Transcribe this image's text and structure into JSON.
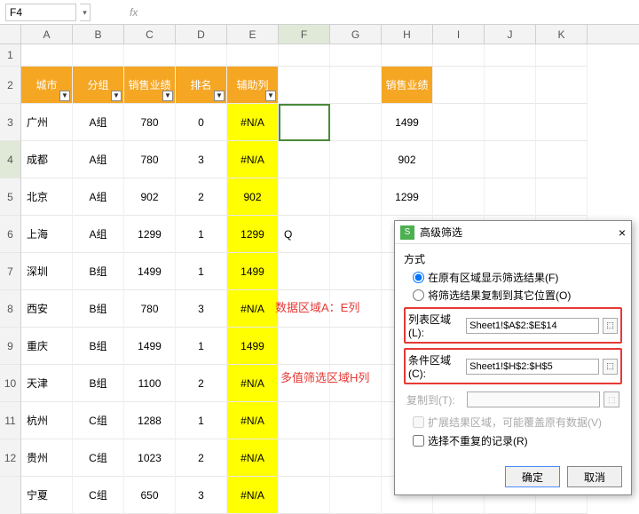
{
  "namebox": "F4",
  "fx": "fx",
  "cols": [
    "A",
    "B",
    "C",
    "D",
    "E",
    "F",
    "G",
    "H",
    "I",
    "J",
    "K"
  ],
  "rows": [
    "1",
    "2",
    "3",
    "4",
    "5",
    "6",
    "7",
    "8",
    "9",
    "10",
    "11",
    "12"
  ],
  "hdr": {
    "a": "城市",
    "b": "分组",
    "c": "销售业绩",
    "d": "排名",
    "e": "辅助列",
    "h": "销售业绩"
  },
  "data": [
    {
      "a": "广州",
      "b": "A组",
      "c": "780",
      "d": "0",
      "e": "#N/A",
      "h": "1499"
    },
    {
      "a": "成都",
      "b": "A组",
      "c": "780",
      "d": "3",
      "e": "#N/A",
      "h": "902"
    },
    {
      "a": "北京",
      "b": "A组",
      "c": "902",
      "d": "2",
      "e": "902",
      "h": "1299"
    },
    {
      "a": "上海",
      "b": "A组",
      "c": "1299",
      "d": "1",
      "e": "1299",
      "h": ""
    },
    {
      "a": "深圳",
      "b": "B组",
      "c": "1499",
      "d": "1",
      "e": "1499",
      "h": ""
    },
    {
      "a": "西安",
      "b": "B组",
      "c": "780",
      "d": "3",
      "e": "#N/A",
      "h": ""
    },
    {
      "a": "重庆",
      "b": "B组",
      "c": "1499",
      "d": "1",
      "e": "1499",
      "h": ""
    },
    {
      "a": "天津",
      "b": "B组",
      "c": "1100",
      "d": "2",
      "e": "#N/A",
      "h": ""
    },
    {
      "a": "杭州",
      "b": "C组",
      "c": "1288",
      "d": "1",
      "e": "#N/A",
      "h": ""
    },
    {
      "a": "贵州",
      "b": "C组",
      "c": "1023",
      "d": "2",
      "e": "#N/A",
      "h": ""
    },
    {
      "a": "宁夏",
      "b": "C组",
      "c": "650",
      "d": "3",
      "e": "#N/A",
      "h": ""
    }
  ],
  "f6": "Q",
  "ann1": "数据区域A：E列",
  "ann2": "多值筛选区域H列",
  "dlg": {
    "title": "高级筛选",
    "mode": "方式",
    "r1": "在原有区域显示筛选结果(F)",
    "r2": "将筛选结果复制到其它位置(O)",
    "list": "列表区域(L):",
    "listv": "Sheet1!$A$2:$E$14",
    "cond": "条件区域(C):",
    "condv": "Sheet1!$H$2:$H$5",
    "copy": "复制到(T):",
    "ext": "扩展结果区域，可能覆盖原有数据(V)",
    "uniq": "选择不重复的记录(R)",
    "ok": "确定",
    "cancel": "取消"
  },
  "chart_data": {
    "type": "table",
    "title": "销售业绩筛选",
    "columns": [
      "城市",
      "分组",
      "销售业绩",
      "排名",
      "辅助列"
    ],
    "rows": [
      [
        "广州",
        "A组",
        780,
        0,
        "#N/A"
      ],
      [
        "成都",
        "A组",
        780,
        3,
        "#N/A"
      ],
      [
        "北京",
        "A组",
        902,
        2,
        902
      ],
      [
        "上海",
        "A组",
        1299,
        1,
        1299
      ],
      [
        "深圳",
        "B组",
        1499,
        1,
        1499
      ],
      [
        "西安",
        "B组",
        780,
        3,
        "#N/A"
      ],
      [
        "重庆",
        "B组",
        1499,
        1,
        1499
      ],
      [
        "天津",
        "B组",
        1100,
        2,
        "#N/A"
      ],
      [
        "杭州",
        "C组",
        1288,
        1,
        "#N/A"
      ],
      [
        "贵州",
        "C组",
        1023,
        2,
        "#N/A"
      ],
      [
        "宁夏",
        "C组",
        650,
        3,
        "#N/A"
      ]
    ],
    "criteria": {
      "销售业绩": [
        1499,
        902,
        1299
      ]
    }
  }
}
